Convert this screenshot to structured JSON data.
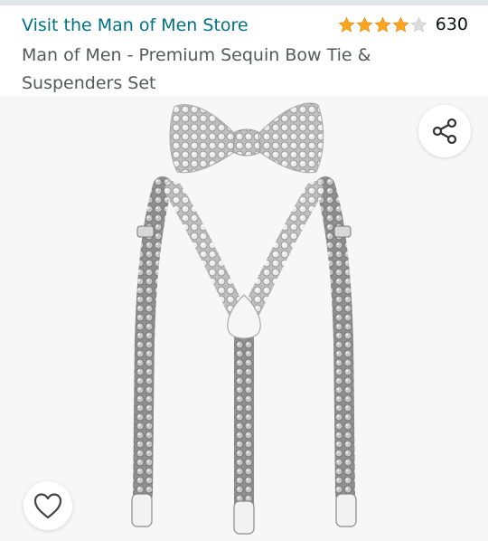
{
  "store": {
    "link_text": "Visit the Man of Men Store"
  },
  "rating": {
    "stars_value": 4,
    "stars_max": 5,
    "count": "630",
    "star_color": "#ffa41c",
    "empty_star_color": "#dddddd"
  },
  "product": {
    "title": "Man of Men - Premium Sequin Bow Tie & Suspenders Set"
  },
  "image": {
    "description_icon": "product-photo-bowtie-suspenders"
  },
  "actions": {
    "share_icon": "share-icon",
    "wishlist_icon": "heart-icon"
  },
  "colors": {
    "link": "#007185",
    "text_secondary": "#565959",
    "image_bg": "#f7f7f7"
  }
}
